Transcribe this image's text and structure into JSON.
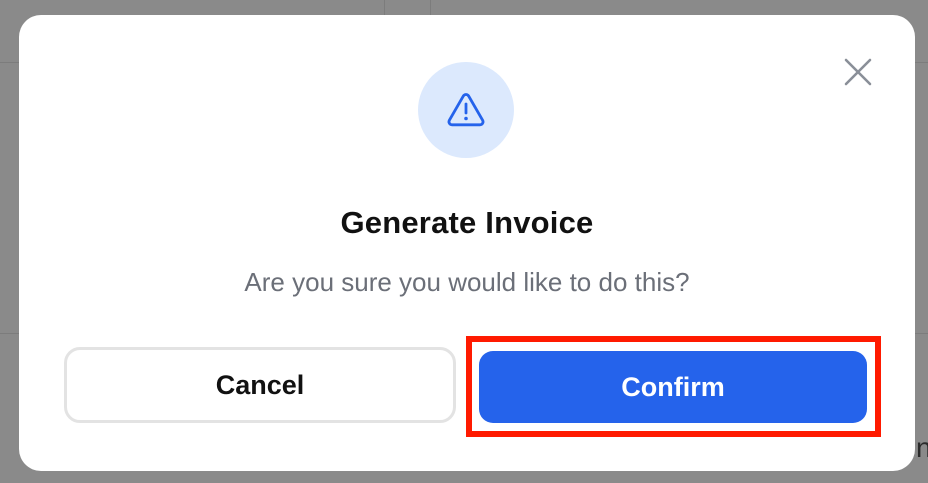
{
  "dialog": {
    "title": "Generate Invoice",
    "message": "Are you sure you would like to do this?",
    "icon": "warning-triangle-icon",
    "close_icon": "close-icon",
    "cancel_label": "Cancel",
    "confirm_label": "Confirm"
  },
  "colors": {
    "primary": "#2563eb",
    "icon_circle": "#dce9fd",
    "highlight": "#ff1a00",
    "overlay": "#8a8a8a"
  }
}
